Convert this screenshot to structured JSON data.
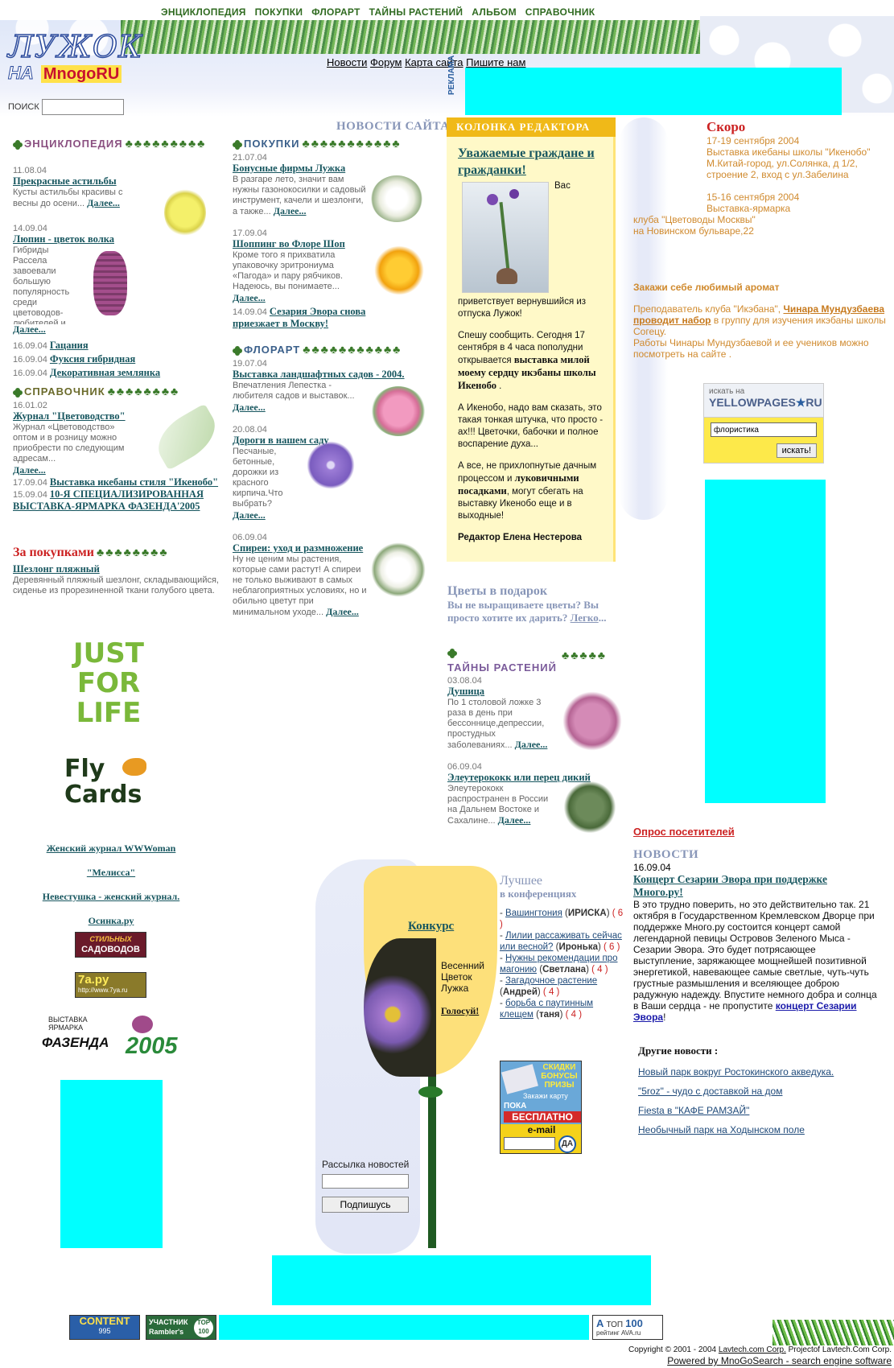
{
  "topnav": [
    "ЭНЦИКЛОПЕДИЯ",
    "ПОКУПКИ",
    "ФЛОРАРТ",
    "ТАЙНЫ РАСТЕНИЙ",
    "АЛЬБОМ",
    "СПРАВОЧНИК"
  ],
  "logo": {
    "line1": "ЛУЖОК",
    "line2": "НА",
    "brand": "MnogoRU"
  },
  "search": {
    "label": "ПОИСК",
    "value": ""
  },
  "subnav": [
    "Новости",
    "Форум",
    "Карта сайта",
    "Пишите нам"
  ],
  "ad_label": "РЕКЛАМА",
  "news_site": "НОВОСТИ САЙТА",
  "encyclopedia": {
    "title": "ЭНЦИКЛОПЕДИЯ",
    "items": [
      {
        "date": "11.08.04",
        "title": "Прекрасные астильбы",
        "text": "Кусты астильбы красивы с весны до осени...",
        "more": "Далее..."
      },
      {
        "date": "14.09.04",
        "title": "Люпин - цветок волка",
        "text": "Гибриды Рассела завоевали большую популярность среди цветоводов-любителей и выращиваются в цветниках...",
        "more": "Далее..."
      }
    ],
    "short": [
      {
        "date": "16.09.04",
        "title": "Гацания"
      },
      {
        "date": "16.09.04",
        "title": "Фуксия гибридная"
      },
      {
        "date": "16.09.04",
        "title": "Декоративная землянка"
      }
    ]
  },
  "reference": {
    "title": "СПРАВОЧНИК",
    "date": "16.01.02",
    "item_title": "Журнал \"Цветоводство\"",
    "text": "Журнал «Цветоводство» оптом и в розницу можно приобрести по следующим адресам...",
    "more": "Далее...",
    "short": [
      {
        "date": "17.09.04",
        "title": "Выставка икебаны стиля \"Икенобо\""
      },
      {
        "date": "15.09.04",
        "title": "10-Я СПЕЦИАЛИЗИРОВАННАЯ ВЫСТАВКА-ЯРМАРКА ФАЗЕНДА'2005"
      }
    ]
  },
  "shopping_left": {
    "title": "За покупками",
    "item_title": "Шезлонг пляжный",
    "text": "Деревянный пляжный шезлонг, складывающийся, сиденье из прорезиненной ткани голубого цвета."
  },
  "purchases": {
    "title": "ПОКУПКИ",
    "items": [
      {
        "date": "21.07.04",
        "title": "Бонусные фирмы Лужка",
        "text": "В разгаре лето, значит вам нужны газонокосилки и садовый инструмент, качели и шезлонги, а также...",
        "more": "Далее..."
      },
      {
        "date": "17.09.04",
        "title": "Шоппинг во Флоре Шоп",
        "text": "Кроме того я прихватила упаковочку эритрониума «Пагода» и пару рябчиков. Надеюсь, вы понимаете...",
        "more": "Далее..."
      }
    ],
    "short": {
      "date": "14.09.04",
      "title": "Сезария Эвора снова приезжает в Москву!"
    }
  },
  "floral": {
    "title": "ФЛОРАРТ",
    "items": [
      {
        "date": "19.07.04",
        "title": "Выставка ландшафтных садов - 2004.",
        "text": "Впечатления Лепестка - любителя садов и выставок...",
        "more": "Далее..."
      },
      {
        "date": "20.08.04",
        "title": "Дороги в нашем саду",
        "text": "Песчаные, бетонные, дорожки из красного кирпича.Что выбрать?",
        "more": "Далее..."
      },
      {
        "date": "06.09.04",
        "title": "Спиреи: уход и размножение",
        "text": "Ну не ценим мы растения, которые сами растут! А спиреи не только выживают в самых неблагоприятных условиях, но и обильно цветут при минимальном уходе...",
        "more": "Далее..."
      }
    ]
  },
  "editor": {
    "header": "КОЛОНКА РЕДАКТОРА",
    "title": "Уважаемые граждане и гражданки!",
    "p0": "Вас",
    "p1": "приветствует вернувшийся из отпуска Лужок!",
    "p2a": "Спешу сообщить. Сегодня 17 сентября в 4 часа пополудни открывается ",
    "p2b": "выставка милой моему сердцу икэбаны школы Икенобо",
    "p2c": " .",
    "p3": "А Икенобо, надо вам сказать, это такая тонкая штучка, что просто - ах!!! Цветочки, бабочки и полное воспарение духа...",
    "p4a": "А все, не прихлопнутые дачным процессом и ",
    "p4b": "луковичными посадками",
    "p4c": ", могут сбегать на выставку Икенобо еще и в выходные!",
    "sign": "Редактор Елена Нестерова"
  },
  "gift": {
    "title": "Цветы в подарок",
    "text": "Вы не выращиваете цветы? Вы просто хотите их дарить?",
    "link": "Легко",
    "tail": "..."
  },
  "secrets": {
    "title": "ТАЙНЫ РАСТЕНИЙ",
    "items": [
      {
        "date": "03.08.04",
        "title": "Душица",
        "text": "По 1 столовой ложке 3 раза в день при бессоннице,депрессии, простудных заболеваниях...",
        "more": "Далее..."
      },
      {
        "date": "06.09.04",
        "title": "Элеутерококк или перец дикий",
        "text": "Элеутерококк распространен в России на Дальнем Востоке и Сахалине...",
        "more": "Далее..."
      }
    ]
  },
  "soon": {
    "title": "Скоро",
    "e1": "17-19 сентября 2004",
    "e2": "Выставка икебаны школы \"Икенобо\"",
    "e3": "М.Китай-город, ул.Солянка, д 1/2, строение 2, вход с ул.Забелина",
    "e4": "15-16 сентября 2004",
    "e5": "Выставка-ярмарка",
    "e6": "клуба \"Цветоводы Москвы\"",
    "e7": "на Новинском бульваре,22"
  },
  "aroma": "Закажи себе любимый аромат",
  "ikebana": {
    "a": "Преподаватель клуба \"Икэбана\", ",
    "b": "Чинара Мундузбаева проводит набор",
    "c": " в группу для изучения икэбаны школы Согецу.",
    "d": "Работы Чинары Мундузбаевой и ее учеников можно посмотреть на сайте ."
  },
  "yellowpages": {
    "label1": "искать на",
    "label2": "YELLOWPAGES",
    "label3": "RU",
    "value": "флористика",
    "button": "искать!"
  },
  "left_links": [
    "Женский журнал WWWoman",
    "\"Мелисса\"",
    "Невестушка - женский журнал.",
    "Осинка.ру"
  ],
  "left_logos": {
    "jfl": [
      "JUST",
      "FOR",
      "LIFE"
    ],
    "fly": [
      "Fly",
      "Cards"
    ],
    "stylish": [
      "СТИЛЬНЫХ",
      "САДОВОДОВ"
    ],
    "ya7": [
      "7a.py",
      "http://www.7ya.ru"
    ],
    "faz": [
      "ВЫСТАВКА",
      "ЯРМАРКА",
      "ФАЗЕНДА",
      "2005"
    ]
  },
  "contest": {
    "link": "Конкурс",
    "t1": "Весенний",
    "t2": "Цветок",
    "t3": "Лужка",
    "vote": "Голосуй!"
  },
  "newsletter": {
    "label": "Рассылка новостей",
    "button": "Подпишусь"
  },
  "conf": {
    "title1": "Лучшее",
    "title2": "в конференциях",
    "items": [
      {
        "title": "Вашингтония",
        "user": "ИРИСКА",
        "count": "( 6 )"
      },
      {
        "title": "Лилии рассаживать сейчас или весной?",
        "user": "Иронька",
        "count": "( 6 )"
      },
      {
        "title": "Нужны рекомендации про магонию",
        "user": "Светлана",
        "count": "( 4 )"
      },
      {
        "title": "Загадочное растение",
        "user": "Андрей",
        "count": "( 4 )"
      },
      {
        "title": "борьба с паутинным клещем",
        "user": "таня",
        "count": "( 4 )"
      }
    ]
  },
  "promo": {
    "l1": "СКИДКИ",
    "l2": "БОНУСЫ",
    "l3": "ПРИЗЫ",
    "l4": "Закажи карту",
    "l5": "ПОКА",
    "l6": "БЕСПЛАТНО",
    "l7": "e-mail",
    "btn": "ДА"
  },
  "poll": "Опрос посетителей",
  "news": {
    "title": "НОВОСТИ",
    "date": "16.09.04",
    "headline": "Концерт Сезарии Эвора при поддержке Много.ру!",
    "text": "В это трудно поверить, но это действительно так. 21 октября в Государственном Кремлевском Дворце при поддержке Много.ру состоится концерт самой легендарной певицы Островов Зеленого Мыса - Сезарии Эвора. Это будет потрясающее выступление, заряжающее мощнейшей позитивной энергетикой, навевающее самые светлые, чуть-чуть грустные размышления и вселяющее доброю радужную надежду. Впустите немного добра и солнца в Ваши сердца - не пропустите ",
    "link": "концерт Сезарии Эвора",
    "end": "!"
  },
  "other_news": {
    "title": "Другие новости :",
    "items": [
      "Новый парк вокруг Ростокинского акведука.",
      "\"5roz\" - чудо с доставкой на дом",
      "Fiesta в \"КАФЕ РАМЗАЙ\"",
      "Необычный парк на Ходынском поле"
    ]
  },
  "footer": {
    "content": "CONTENT",
    "content_n": "995",
    "rambler1": "УЧАСТНИК",
    "rambler2": "Rambler's",
    "rambler3": "TOP",
    "rambler4": "100",
    "ava1": "ТОП",
    "ava2": "100",
    "ava3": "рейтинг AVA.ru",
    "copy1": "Copyright © 2001 - 2004 ",
    "copy_link1": "Lavtech.com Corp.",
    "copy2": " Projectof Lavtech.Com Corp.",
    "powered": "Powered by MnoGoSearch - search engine software"
  }
}
